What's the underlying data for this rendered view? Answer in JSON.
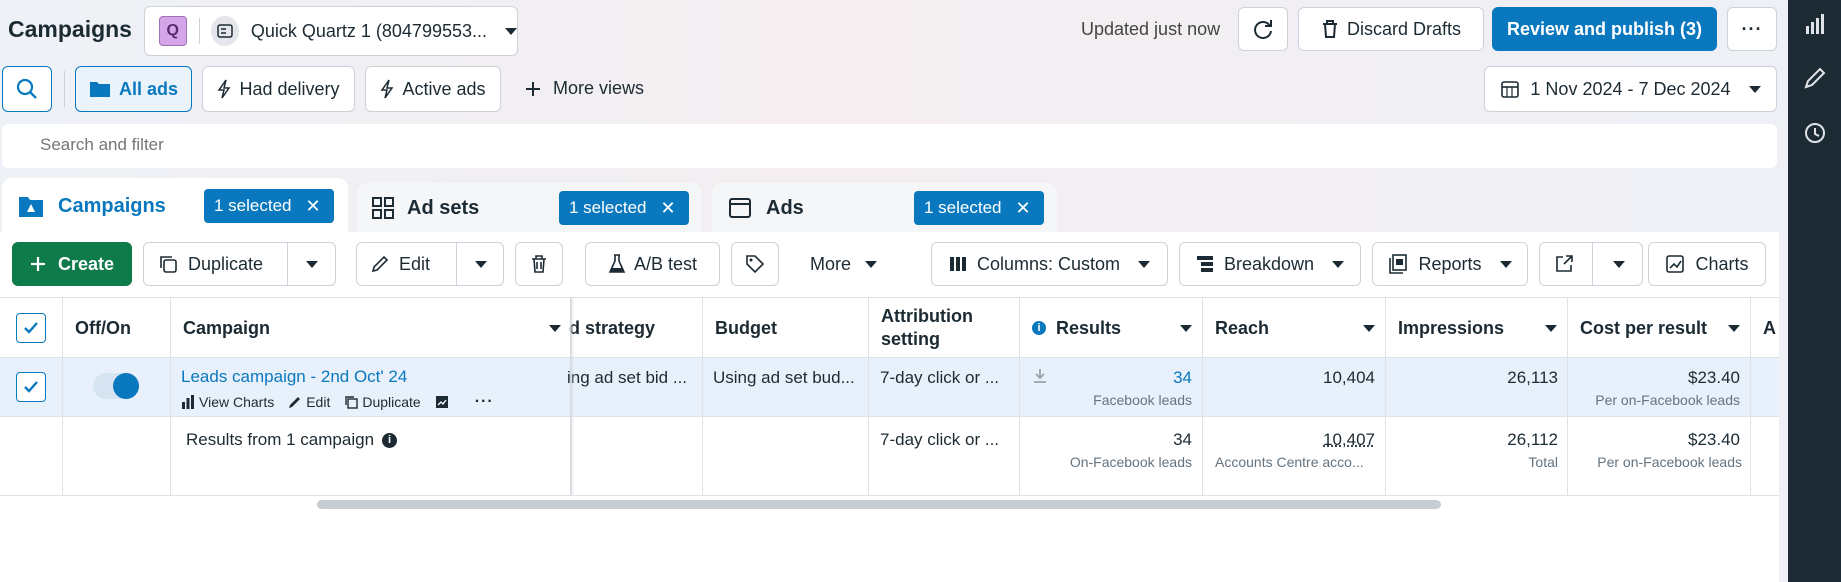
{
  "header": {
    "title": "Campaigns",
    "account_initial": "Q",
    "account_name": "Quick Quartz 1 (804799553...",
    "updated": "Updated just now",
    "discard": "Discard Drafts",
    "publish": "Review and publish (3)",
    "more": "···"
  },
  "filters": {
    "all_ads": "All ads",
    "had_delivery": "Had delivery",
    "active_ads": "Active ads",
    "more_views": "More views",
    "date_range": "1 Nov 2024 - 7 Dec 2024",
    "search_placeholder": "Search and filter"
  },
  "tabs": [
    {
      "label": "Campaigns",
      "badge": "1 selected"
    },
    {
      "label": "Ad sets",
      "badge": "1 selected"
    },
    {
      "label": "Ads",
      "badge": "1 selected"
    }
  ],
  "toolbar": {
    "create": "Create",
    "duplicate": "Duplicate",
    "edit": "Edit",
    "ab_test": "A/B test",
    "more": "More",
    "columns": "Columns: Custom",
    "breakdown": "Breakdown",
    "reports": "Reports",
    "charts": "Charts"
  },
  "table": {
    "headers": {
      "offon": "Off/On",
      "campaign": "Campaign",
      "bid_strategy": "d strategy",
      "budget": "Budget",
      "attribution_1": "Attribution",
      "attribution_2": "setting",
      "results": "Results",
      "reach": "Reach",
      "impressions": "Impressions",
      "cost_per_result": "Cost per result",
      "amount": "A"
    },
    "row": {
      "campaign_name": "Leads campaign - 2nd Oct' 24",
      "actions": {
        "view_charts": "View Charts",
        "edit": "Edit",
        "duplicate": "Duplicate"
      },
      "bid_strategy": "ing ad set bid ...",
      "budget": "Using ad set bud...",
      "attribution": "7-day click or ...",
      "results": "34",
      "results_sub": "Facebook leads",
      "reach": "10,404",
      "impressions": "26,113",
      "cost": "$23.40",
      "cost_sub": "Per on-Facebook leads"
    },
    "summary": {
      "label": "Results from 1 campaign",
      "attribution": "7-day click or ...",
      "results": "34",
      "results_sub": "On-Facebook leads",
      "reach": "10,407",
      "reach_sub": "Accounts Centre acco...",
      "impressions": "26,112",
      "impressions_sub": "Total",
      "cost": "$23.40",
      "cost_sub": "Per on-Facebook leads"
    }
  },
  "colors": {
    "accent": "#0a78be",
    "create": "#0f7a4a",
    "rail": "#1c2b33"
  }
}
